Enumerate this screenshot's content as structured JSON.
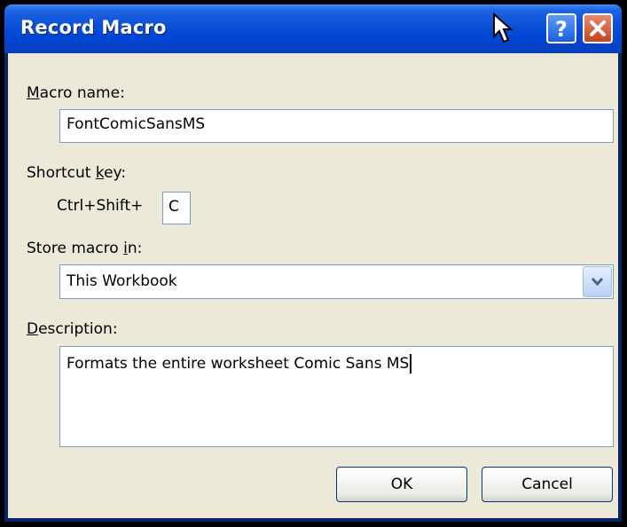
{
  "window": {
    "title": "Record Macro"
  },
  "titlebar_icons": {
    "help": "help-icon",
    "close": "close-icon",
    "cursor": "mouse-pointer-icon"
  },
  "macro_name": {
    "label_u": "M",
    "label_rest": "acro name:",
    "value": "FontComicSansMS"
  },
  "shortcut": {
    "label_pre": "Shortcut ",
    "label_u": "k",
    "label_post": "ey:",
    "prefix": "Ctrl+Shift+",
    "value": "C"
  },
  "store": {
    "label_pre": "Store macro ",
    "label_u": "i",
    "label_post": "n:",
    "value": "This Workbook"
  },
  "description": {
    "label_u": "D",
    "label_rest": "escription:",
    "value": "Formats the entire worksheet Comic Sans MS"
  },
  "buttons": {
    "ok": "OK",
    "cancel": "Cancel"
  },
  "colors": {
    "titlebar": "#0a4fd6",
    "client": "#ece9d8",
    "field_border": "#7f9db9",
    "close": "#c4451f"
  }
}
